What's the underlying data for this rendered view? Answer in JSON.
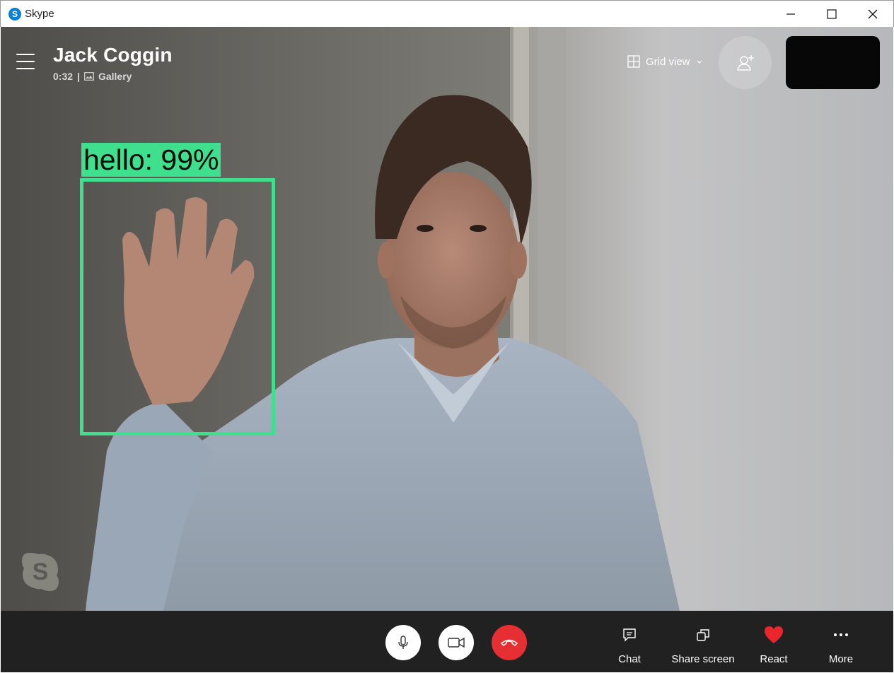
{
  "window": {
    "title": "Skype",
    "logo_letter": "S"
  },
  "call": {
    "contact_name": "Jack Coggin",
    "duration": "0:32",
    "separator": "|",
    "view_mode": "Gallery"
  },
  "top_controls": {
    "layout_label": "Grid view"
  },
  "detection": {
    "label": "hello: 99%",
    "color": "#3ee08e"
  },
  "bottom_controls": {
    "chat_label": "Chat",
    "share_label": "Share screen",
    "react_label": "React",
    "more_label": "More",
    "end_call_color": "#e52f32",
    "react_color": "#e8262c"
  },
  "icons": [
    "skype-logo",
    "minimize-icon",
    "maximize-icon",
    "close-icon",
    "hamburger-icon",
    "gallery-icon",
    "grid-icon",
    "chevron-down-icon",
    "add-person-icon",
    "microphone-icon",
    "video-camera-icon",
    "end-call-icon",
    "chat-icon",
    "share-screen-icon",
    "heart-icon",
    "more-icon",
    "skype-watermark-icon"
  ]
}
